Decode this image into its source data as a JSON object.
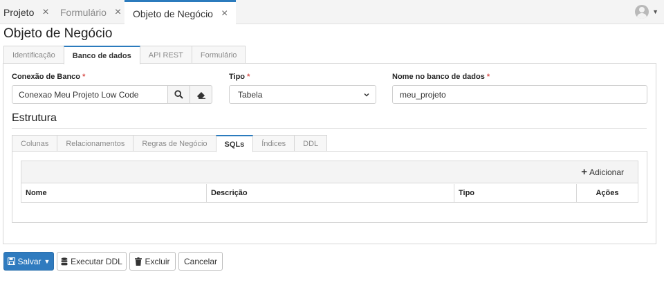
{
  "top_tabs": [
    {
      "label": "Projeto"
    },
    {
      "label": "Formulário"
    },
    {
      "label": "Objeto de Negócio"
    }
  ],
  "page_title": "Objeto de Negócio",
  "main_tabs": [
    "Identificação",
    "Banco de dados",
    "API REST",
    "Formulário"
  ],
  "form": {
    "conexao": {
      "label": "Conexão de Banco",
      "required": "*",
      "value": "Conexao Meu Projeto Low Code"
    },
    "tipo": {
      "label": "Tipo",
      "required": "*",
      "value": "Tabela"
    },
    "nome": {
      "label": "Nome no banco de dados",
      "required": "*",
      "value": "meu_projeto"
    }
  },
  "section_title": "Estrutura",
  "sub_tabs": [
    "Colunas",
    "Relacionamentos",
    "Regras de Negócio",
    "SQLs",
    "Índices",
    "DDL"
  ],
  "grid": {
    "add_label": "Adicionar",
    "columns": [
      "Nome",
      "Descrição",
      "Tipo",
      "Ações"
    ]
  },
  "actions": {
    "save": "Salvar",
    "run_ddl": "Executar DDL",
    "delete": "Excluir",
    "cancel": "Cancelar"
  },
  "colors": {
    "accent": "#2b7bbd",
    "required": "#d9534f",
    "primary_button": "#2f7bbf"
  }
}
